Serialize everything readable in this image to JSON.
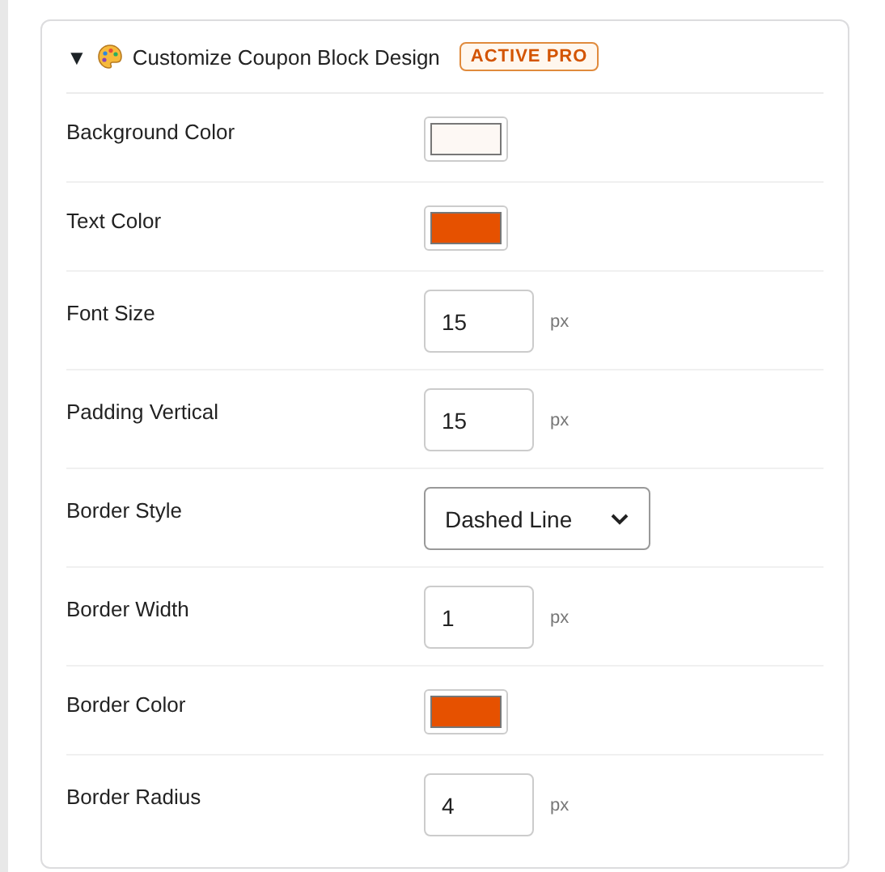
{
  "section": {
    "toggle": "▼",
    "expanded": true,
    "title": "Customize Coupon Block Design",
    "badge": "ACTIVE PRO"
  },
  "settings": [
    {
      "kind": "color",
      "label": "Background Color",
      "color": "#fdf8f4"
    },
    {
      "kind": "color",
      "label": "Text Color",
      "color": "#e65100"
    },
    {
      "kind": "number",
      "label": "Font Size",
      "value": "15",
      "unit": "px"
    },
    {
      "kind": "number",
      "label": "Padding Vertical",
      "value": "15",
      "unit": "px"
    },
    {
      "kind": "select",
      "label": "Border Style",
      "value": "Dashed Line"
    },
    {
      "kind": "number",
      "label": "Border Width",
      "value": "1",
      "unit": "px"
    },
    {
      "kind": "color",
      "label": "Border Color",
      "color": "#e65100"
    },
    {
      "kind": "number",
      "label": "Border Radius",
      "value": "4",
      "unit": "px"
    }
  ]
}
